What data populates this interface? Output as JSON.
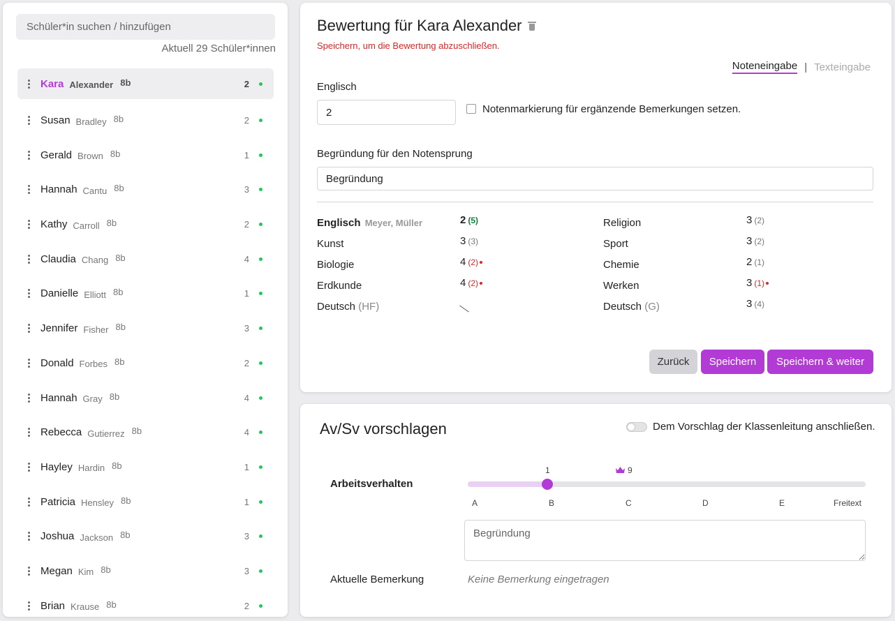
{
  "sidebar": {
    "search_placeholder": "Schüler*in suchen / hinzufügen",
    "count": "Aktuell 29 Schüler*innen",
    "students": [
      {
        "first": "Kara",
        "last": "Alexander",
        "class": "8b",
        "grade": "2",
        "active": true
      },
      {
        "first": "Susan",
        "last": "Bradley",
        "class": "8b",
        "grade": "2"
      },
      {
        "first": "Gerald",
        "last": "Brown",
        "class": "8b",
        "grade": "1"
      },
      {
        "first": "Hannah",
        "last": "Cantu",
        "class": "8b",
        "grade": "3"
      },
      {
        "first": "Kathy",
        "last": "Carroll",
        "class": "8b",
        "grade": "2"
      },
      {
        "first": "Claudia",
        "last": "Chang",
        "class": "8b",
        "grade": "4"
      },
      {
        "first": "Danielle",
        "last": "Elliott",
        "class": "8b",
        "grade": "1"
      },
      {
        "first": "Jennifer",
        "last": "Fisher",
        "class": "8b",
        "grade": "3"
      },
      {
        "first": "Donald",
        "last": "Forbes",
        "class": "8b",
        "grade": "2"
      },
      {
        "first": "Hannah",
        "last": "Gray",
        "class": "8b",
        "grade": "4"
      },
      {
        "first": "Rebecca",
        "last": "Gutierrez",
        "class": "8b",
        "grade": "4"
      },
      {
        "first": "Hayley",
        "last": "Hardin",
        "class": "8b",
        "grade": "1"
      },
      {
        "first": "Patricia",
        "last": "Hensley",
        "class": "8b",
        "grade": "1"
      },
      {
        "first": "Joshua",
        "last": "Jackson",
        "class": "8b",
        "grade": "3"
      },
      {
        "first": "Megan",
        "last": "Kim",
        "class": "8b",
        "grade": "3"
      },
      {
        "first": "Brian",
        "last": "Krause",
        "class": "8b",
        "grade": "2"
      }
    ]
  },
  "evaluation": {
    "title": "Bewertung für Kara Alexander",
    "warning": "Speichern, um die Bewertung abzuschließen.",
    "mode_active": "Noteneingabe",
    "mode_separator": "|",
    "mode_inactive": "Texteingabe",
    "subject_label": "Englisch",
    "grade_value": "2",
    "checkbox_label": "Notenmarkierung für ergänzende Bemerkungen setzen.",
    "reason_label": "Begründung für den Notensprung",
    "reason_value": "Begründung",
    "left_grades": [
      {
        "subject": "Englisch",
        "teachers": "Meyer, Müller",
        "grade": "2",
        "sub": "(5)",
        "style": "green",
        "bold": true
      },
      {
        "subject": "Kunst",
        "grade": "3",
        "sub": "(3)"
      },
      {
        "subject": "Biologie",
        "grade": "4",
        "sub": "(2)",
        "style": "red"
      },
      {
        "subject": "Erdkunde",
        "grade": "4",
        "sub": "(2)",
        "style": "red"
      },
      {
        "subject": "Deutsch",
        "suffix": "(HF)",
        "grade": "",
        "sub": "",
        "slash": true
      }
    ],
    "right_grades": [
      {
        "subject": "Religion",
        "grade": "3",
        "sub": "(2)"
      },
      {
        "subject": "Sport",
        "grade": "3",
        "sub": "(2)"
      },
      {
        "subject": "Chemie",
        "grade": "2",
        "sub": "(1)"
      },
      {
        "subject": "Werken",
        "grade": "3",
        "sub": "(1)",
        "style": "red"
      },
      {
        "subject": "Deutsch",
        "suffix": "(G)",
        "grade": "3",
        "sub": "(4)"
      }
    ],
    "buttons": {
      "back": "Zurück",
      "save": "Speichern",
      "save_next": "Speichern & weiter"
    }
  },
  "avsv": {
    "title": "Av/Sv vorschlagen",
    "toggle_label": "Dem Vorschlag der Klassenleitung anschließen.",
    "behavior_label": "Arbeitsverhalten",
    "slider_value_label": "1",
    "slider_position": 0.2,
    "crown_count": "9",
    "ticks": [
      "A",
      "B",
      "C",
      "D",
      "E",
      "Freitext"
    ],
    "textarea_placeholder": "Begründung",
    "remark_label": "Aktuelle Bemerkung",
    "remark_value": "Keine Bemerkung eingetragen"
  },
  "colors": {
    "accent": "#b33bd5",
    "ok": "#22c55e",
    "error": "#dc2626"
  }
}
